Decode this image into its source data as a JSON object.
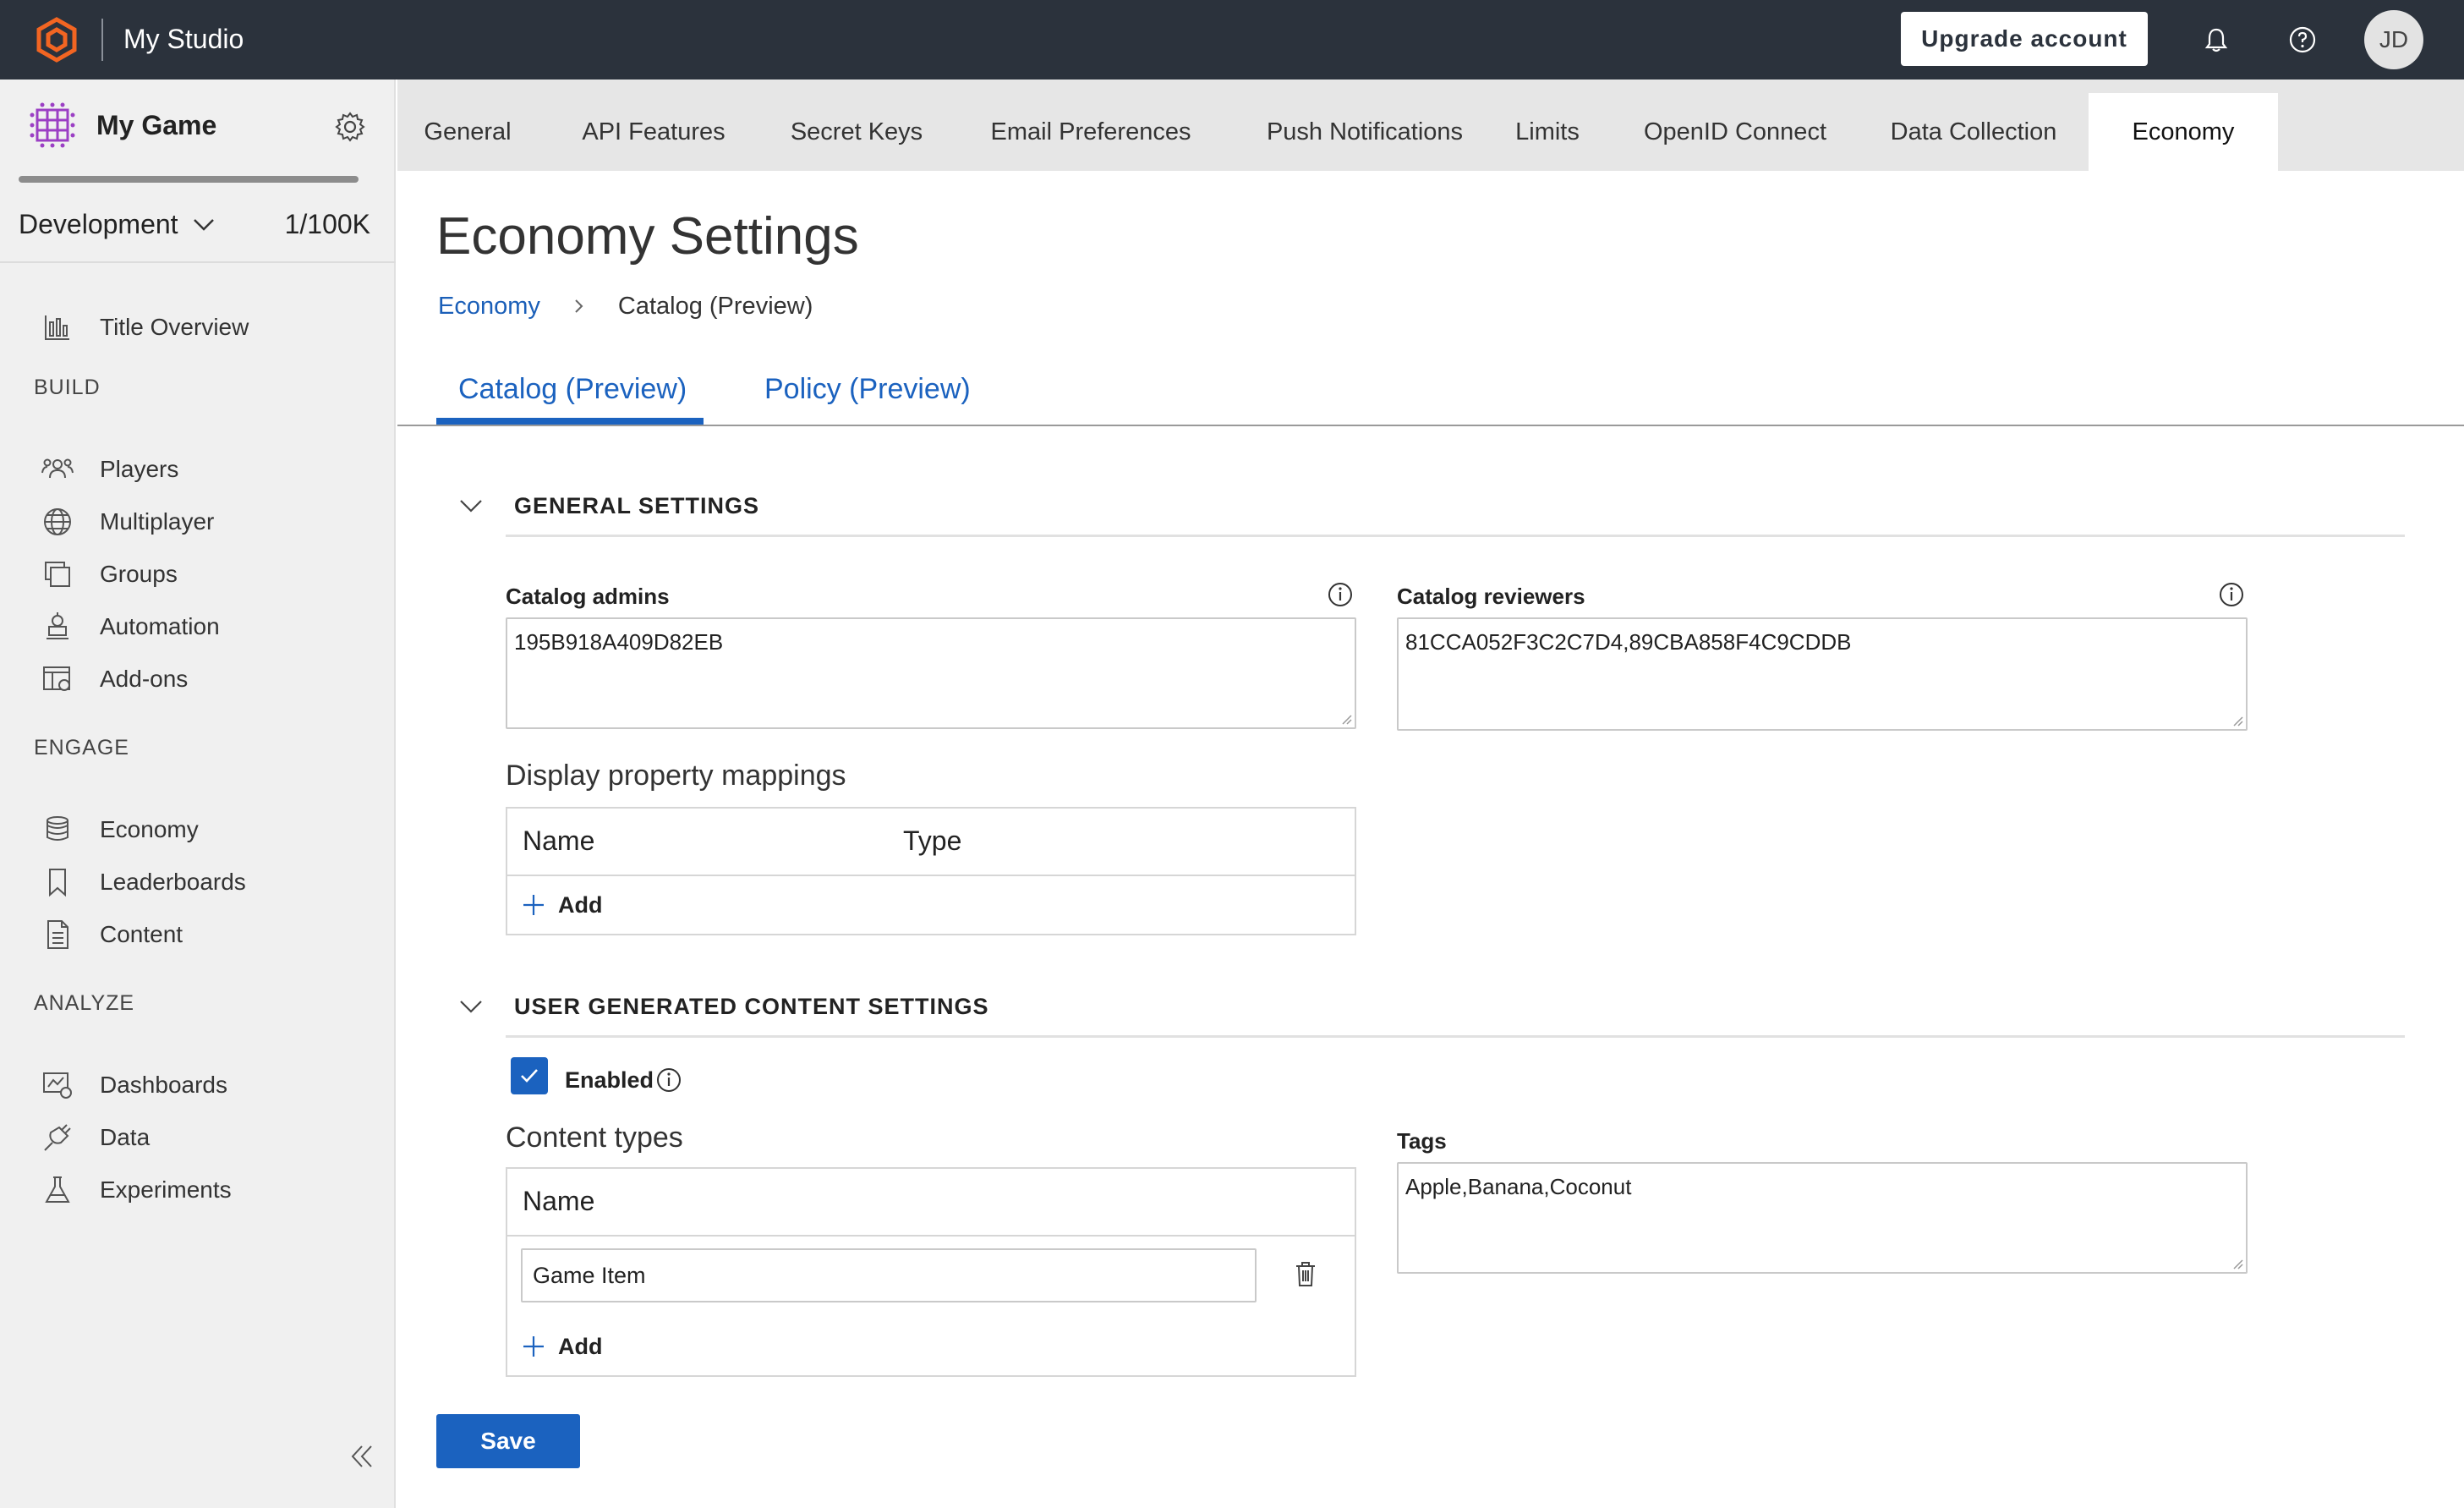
{
  "header": {
    "studio_name": "My Studio",
    "upgrade_label": "Upgrade account",
    "avatar_initials": "JD",
    "icons": {
      "logo": "hexagon-logo-icon",
      "notifications": "bell-icon",
      "help": "help-circle-icon"
    },
    "colors": {
      "bar": "#2b323c",
      "logo": "#f26522"
    }
  },
  "sidebar": {
    "game_name": "My Game",
    "environment": "Development",
    "usage": "1/100K",
    "overview": {
      "label": "Title Overview",
      "icon": "bar-chart-icon"
    },
    "sections": [
      {
        "label": "BUILD",
        "items": [
          {
            "label": "Players",
            "icon": "players-icon"
          },
          {
            "label": "Multiplayer",
            "icon": "globe-icon"
          },
          {
            "label": "Groups",
            "icon": "groups-icon"
          },
          {
            "label": "Automation",
            "icon": "robot-icon"
          },
          {
            "label": "Add-ons",
            "icon": "addons-icon"
          }
        ]
      },
      {
        "label": "ENGAGE",
        "items": [
          {
            "label": "Economy",
            "icon": "coins-icon"
          },
          {
            "label": "Leaderboards",
            "icon": "bookmark-icon"
          },
          {
            "label": "Content",
            "icon": "document-icon"
          }
        ]
      },
      {
        "label": "ANALYZE",
        "items": [
          {
            "label": "Dashboards",
            "icon": "dashboard-icon"
          },
          {
            "label": "Data",
            "icon": "plug-icon"
          },
          {
            "label": "Experiments",
            "icon": "flask-icon"
          }
        ]
      }
    ]
  },
  "tabs": [
    {
      "label": "General",
      "active": false
    },
    {
      "label": "API Features",
      "active": false
    },
    {
      "label": "Secret Keys",
      "active": false
    },
    {
      "label": "Email Preferences",
      "active": false
    },
    {
      "label": "Push Notifications",
      "active": false
    },
    {
      "label": "Limits",
      "active": false
    },
    {
      "label": "OpenID Connect",
      "active": false
    },
    {
      "label": "Data Collection",
      "active": false
    },
    {
      "label": "Economy",
      "active": true
    }
  ],
  "main": {
    "title": "Economy Settings",
    "breadcrumb": {
      "parent": "Economy",
      "current": "Catalog (Preview)"
    },
    "subtabs": [
      {
        "label": "Catalog (Preview)",
        "active": true
      },
      {
        "label": "Policy (Preview)",
        "active": false
      }
    ],
    "general": {
      "title": "GENERAL SETTINGS",
      "admins_label": "Catalog admins",
      "admins_value": "195B918A409D82EB",
      "reviewers_label": "Catalog reviewers",
      "reviewers_value": "81CCA052F3C2C7D4,89CBA858F4C9CDDB",
      "mappings_title": "Display property mappings",
      "mappings_columns": [
        "Name",
        "Type"
      ],
      "add_label": "Add"
    },
    "ugc": {
      "title": "USER GENERATED CONTENT SETTINGS",
      "enabled_label": "Enabled",
      "enabled": true,
      "content_types_title": "Content types",
      "content_types_column": "Name",
      "content_type_rows": [
        "Game Item"
      ],
      "add_label": "Add",
      "tags_label": "Tags",
      "tags_value": "Apple,Banana,Coconut"
    },
    "save_label": "Save",
    "accent_color": "#1b62bf"
  }
}
